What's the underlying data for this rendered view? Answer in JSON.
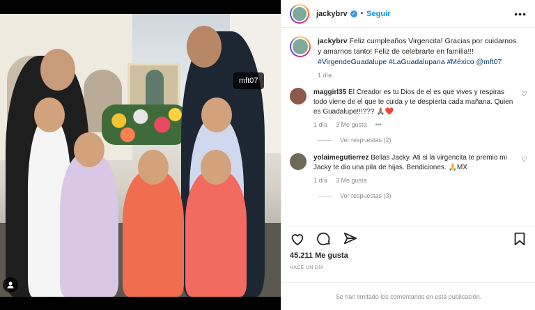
{
  "post": {
    "username": "jackybrv",
    "follow_label": "Seguir",
    "separator": "•",
    "more_label": "•••",
    "photo_tag": "mft07"
  },
  "caption": {
    "username": "jackybrv",
    "text": "Feliz cumpleaños Virgencita! Gracias por cuidarnos y amarnos tanto! Feliz de celebrarte en familia!!!",
    "hashtags": "#VirgendeGuadalupe #LaGuadalupana #México @mft07",
    "time": "1 día"
  },
  "comments": [
    {
      "username": "maggirl35",
      "text": "El Creador es tu Dios de el es que vives y respiras todo viene de el que te cuida y te despierta cada mañana. Quien es Guadalupe!!!??? 🙏🏽❤️",
      "time": "1 día",
      "likes": "3 Me gusta",
      "more": "•••",
      "replies": "Ver respuestas (2)"
    },
    {
      "username": "yolaimegutierrez",
      "text": "Bellas Jacky. Ati si la virgencita te premio mi Jacky te dio una pila de hijas. Bendiciones. 🙏MX",
      "time": "1 día",
      "likes": "3 Me gusta",
      "replies": "Ver respuestas (3)"
    }
  ],
  "stats": {
    "likes": "45.211 Me gusta",
    "ago": "HACE UN DÍA",
    "limited": "Se han limitado los comentarios en esta publicación."
  },
  "colors": {
    "link": "#0095f6",
    "hashtag": "#00376b",
    "muted": "#8e8e8e"
  }
}
